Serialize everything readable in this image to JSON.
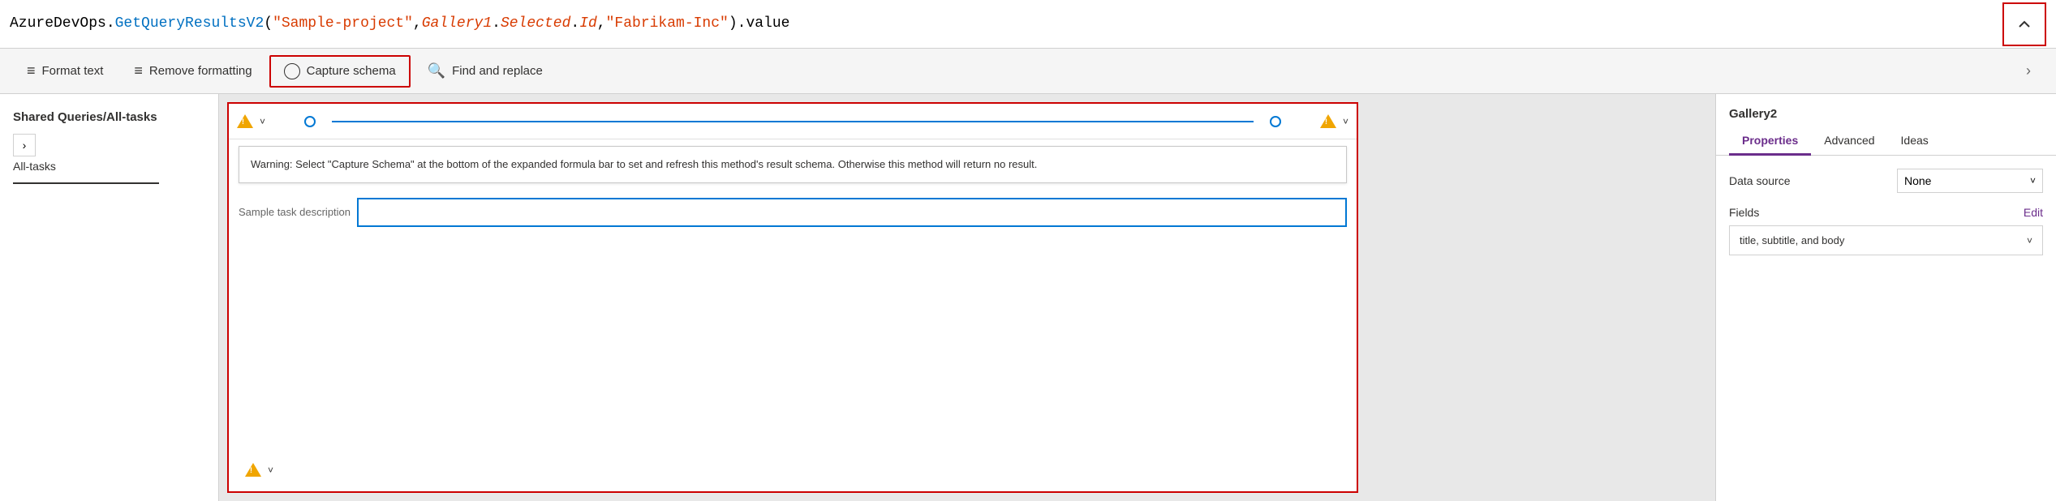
{
  "formula": {
    "prefix": "AzureDevOps.",
    "method": "GetQueryResultsV2",
    "param1": "\"Sample-project\"",
    "separator1": ",",
    "param2_part1": "Gallery1",
    "param2_sep": ".",
    "param2_part2": "Selected",
    "param2_sep2": ".",
    "param2_part3": "Id",
    "separator2": ",",
    "param3": "\"Fabrikam-Inc\"",
    "suffix": ").value"
  },
  "formula_display": "AzureDevOps.GetQueryResultsV2(\"Sample-project\",Gallery1.Selected.Id,\"Fabrikam-Inc\").value",
  "toolbar": {
    "format_text_label": "Format text",
    "remove_formatting_label": "Remove formatting",
    "capture_schema_label": "Capture schema",
    "find_replace_label": "Find and replace"
  },
  "sidebar": {
    "title": "Gallery2",
    "tabs": [
      {
        "label": "Properties",
        "active": true
      },
      {
        "label": "Advanced",
        "active": false
      },
      {
        "label": "Ideas",
        "active": false
      }
    ],
    "data_source_label": "Data source",
    "data_source_value": "None",
    "fields_label": "Fields",
    "fields_edit": "Edit",
    "fields_layout": "title, subtitle, and body"
  },
  "left_panel": {
    "title": "Shared Queries/All-tasks",
    "item": "All-tasks"
  },
  "warning": {
    "text": "Warning: Select \"Capture Schema\" at the bottom of the expanded formula bar to set and refresh this method's result schema. Otherwise this method will return no result."
  },
  "gallery_sample": {
    "description": "Sample task description"
  },
  "icons": {
    "format_text": "≡",
    "remove_formatting": "≡",
    "capture_schema": "○",
    "find_replace": "⌕",
    "chevron_up": "∧",
    "chevron_right": "›",
    "chevron_down": "˅",
    "warning": "⚠"
  }
}
